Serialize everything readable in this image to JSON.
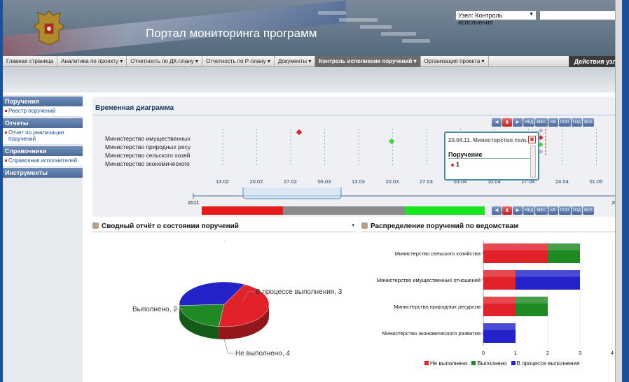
{
  "header": {
    "title": "Портал мониторинга программ",
    "node_label": "Узел: Контроль исполнения",
    "node_arrow": "▼"
  },
  "menu": {
    "items": [
      "Главная страница",
      "Аналитика по проекту ▾",
      "Отчетность по ДК-плану ▾",
      "Отчетность по Р-плану ▾",
      "Документы ▾",
      "Контроль исполнения поручений ▾",
      "Организация проекта ▾"
    ],
    "active_index": 5,
    "site_actions": "Действия узл"
  },
  "sidebar": {
    "sections": [
      {
        "title": "Поручения",
        "items": [
          "Реестр поручений"
        ]
      },
      {
        "title": "Отчеты",
        "items": [
          "Отчет по реализации поручений"
        ]
      },
      {
        "title": "Справочники",
        "items": [
          "Справочник исполнителей"
        ]
      },
      {
        "title": "Инструменты",
        "items": []
      }
    ]
  },
  "gantt": {
    "title": "Временная диаграмма",
    "rows": [
      "Министерство имущественных",
      "Министерство природных ресу",
      "Министерство сельского хозяй",
      "Министерство экономического"
    ],
    "dates": [
      "13.02",
      "20.02",
      "27.02",
      "06.03",
      "13.03",
      "20.03",
      "27.03",
      "03.04",
      "10.04",
      "17.04",
      "24.04",
      "01.05"
    ],
    "nav_buttons": [
      "◀",
      "▮",
      "▶",
      "НЕД",
      "МЕС",
      "КВ",
      "ПОЛ",
      "ГОД",
      "ВСЕ"
    ],
    "timeline_start": "2011",
    "timeline_end": "201",
    "tooltip": {
      "title": "20.04.11. Министерство сель",
      "close": "✖",
      "header": "Поручение",
      "value": "1"
    }
  },
  "pie_panel": {
    "title": "Сводный отчёт о состоянии поручений",
    "dropdown": "▾",
    "chart_data": {
      "type": "pie",
      "slices": [
        {
          "label": "Не выполнено",
          "value": 4,
          "color": "#e2222a"
        },
        {
          "label": "Выполнено",
          "value": 2,
          "color": "#1f8a24"
        },
        {
          "label": "В процессе выполнения",
          "value": 3,
          "color": "#2323c9"
        }
      ],
      "labels": [
        "Не выполнено, 4",
        "Выполнено, 2",
        "В процессе выполнения, 3"
      ]
    }
  },
  "bar_panel": {
    "title": "Распределение поручений по ведомствам",
    "chart_data": {
      "type": "bar",
      "orientation": "horizontal",
      "stacked": true,
      "categories": [
        "Министерство сельского хозяйства",
        "Министерство имущественных отношений",
        "Министерство природных ресурсов",
        "Министерство экономического развития"
      ],
      "series": [
        {
          "name": "Не выполнено",
          "color": "#e2222a",
          "values": [
            2,
            1,
            1,
            0
          ]
        },
        {
          "name": "Выполнено",
          "color": "#1f8a24",
          "values": [
            1,
            0,
            1,
            0
          ]
        },
        {
          "name": "В процессе выполнения",
          "color": "#2323c9",
          "values": [
            0,
            2,
            0,
            1
          ]
        }
      ],
      "xlim": [
        0,
        4
      ],
      "xticks": [
        "0",
        "1",
        "2",
        "3",
        "4"
      ],
      "legend": "bottom"
    }
  }
}
